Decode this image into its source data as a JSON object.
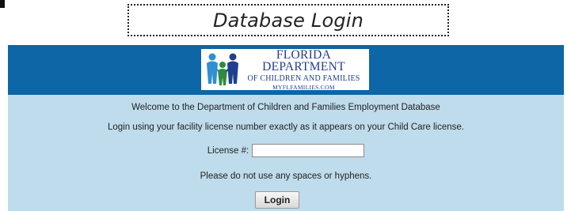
{
  "page": {
    "title": "Database Login"
  },
  "header": {
    "logo": {
      "line1": "FLORIDA DEPARTMENT",
      "line2": "OF CHILDREN AND FAMILIES",
      "line3": "MYFLFAMILIES.COM",
      "icon": "family-figures-icon",
      "colors": {
        "navy": "#1f3e8f",
        "blue": "#2f8fd0",
        "green": "#2e8b3e"
      }
    },
    "band_color": "#0d66a5"
  },
  "form": {
    "welcome_text": "Welcome to the Department of Children and Families Employment Database",
    "instruction_text": "Login using your facility license number exactly as it appears on your Child Care license.",
    "license_label": "License #:",
    "license_value": "",
    "hint_text": "Please do not use any spaces or hyphens.",
    "login_label": "Login",
    "background_color": "#bfdcec"
  }
}
